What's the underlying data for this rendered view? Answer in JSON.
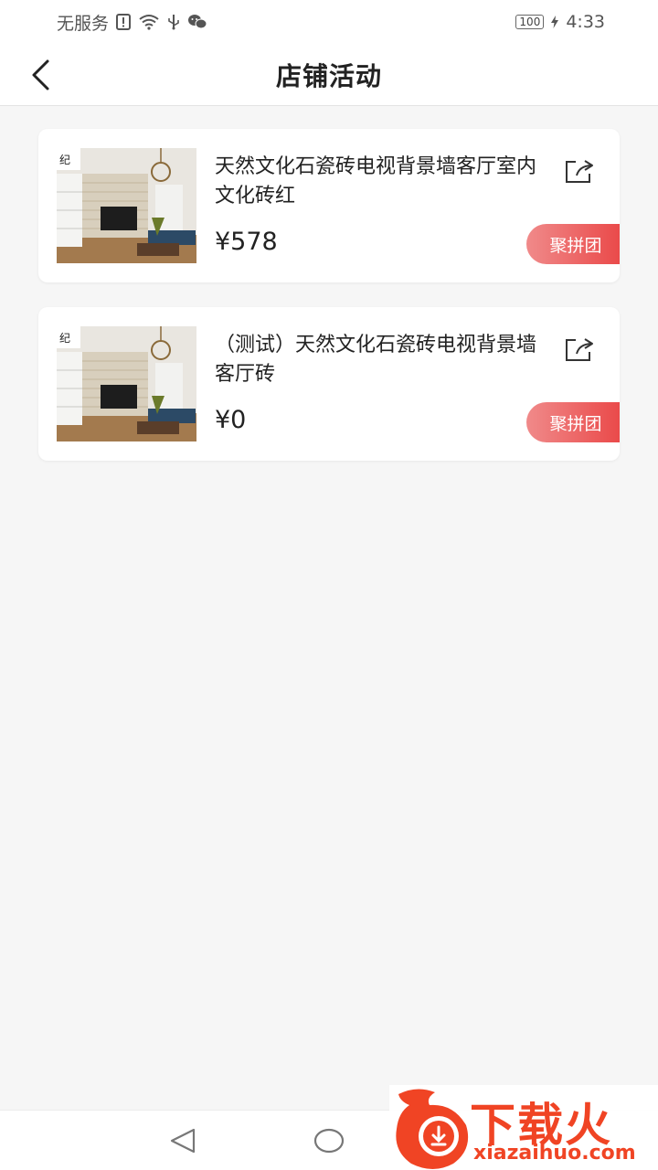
{
  "status_bar": {
    "carrier": "无服务",
    "battery": "100",
    "time": "4:33"
  },
  "header": {
    "title": "店铺活动"
  },
  "activities": [
    {
      "title": "天然文化石瓷砖电视背景墙客厅室内文化砖红",
      "price": "¥578",
      "badge": "聚拼团"
    },
    {
      "title": "（测试）天然文化石瓷砖电视背景墙客厅砖",
      "price": "¥0",
      "badge": "聚拼团"
    }
  ],
  "watermark": {
    "brand": "下载火",
    "url": "xiazaihuo.com"
  },
  "colors": {
    "badge_start": "#f08a8a",
    "badge_end": "#ea4a4a",
    "watermark": "#f04424",
    "background": "#f6f6f6"
  }
}
